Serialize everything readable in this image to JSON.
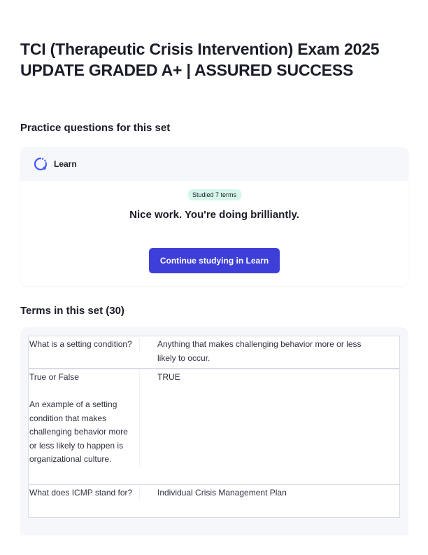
{
  "page": {
    "title_line1": "TCI (Therapeutic Crisis Intervention) Exam 2025",
    "title_line2": "UPDATE GRADED A+ | ASSURED SUCCESS"
  },
  "practice": {
    "heading": "Practice questions for this set",
    "mode_label": "Learn",
    "mode_icon": "learn-progress-icon",
    "badge": "Studied 7 terms",
    "message": "Nice work. You're doing brilliantly.",
    "button_label": "Continue studying in Learn"
  },
  "terms": {
    "heading": "Terms in this set (30)",
    "items": [
      {
        "term": "What is a setting condition?",
        "definition": "Anything that makes challenging behavior more or less likely to occur."
      },
      {
        "term": "True or False\n\nAn example of a setting condition that makes challenging behavior more or less likely to happen is organizational culture.",
        "definition": "TRUE"
      },
      {
        "term": "What does ICMP stand for?",
        "definition": "Individual Crisis Management Plan"
      }
    ]
  },
  "colors": {
    "accent": "#3d3fd8",
    "badge_bg": "#d7f6ea",
    "panel_bg": "#f6f7fb",
    "icon_blue": "#4255ff"
  }
}
